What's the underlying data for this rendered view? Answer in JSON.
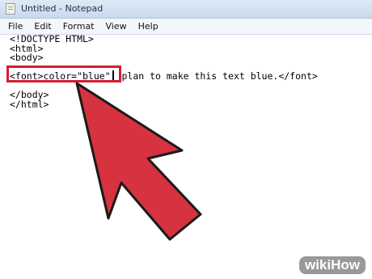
{
  "window": {
    "title": "Untitled - Notepad",
    "app_icon": "notepad-icon"
  },
  "menu": {
    "items": [
      "File",
      "Edit",
      "Format",
      "View",
      "Help"
    ]
  },
  "editor": {
    "lines": [
      "<!DOCTYPE HTML>",
      "<html>",
      "<body>",
      "",
      "<font>color=\"blue\"  plan to make this text blue.</font>",
      "",
      "</body>",
      "</html>"
    ]
  },
  "annotation": {
    "box_color": "#d51e2e",
    "arrow_color": "#d6323f",
    "arrow_stroke": "#1a1a1a"
  },
  "watermark": {
    "text": "wikiHow"
  }
}
